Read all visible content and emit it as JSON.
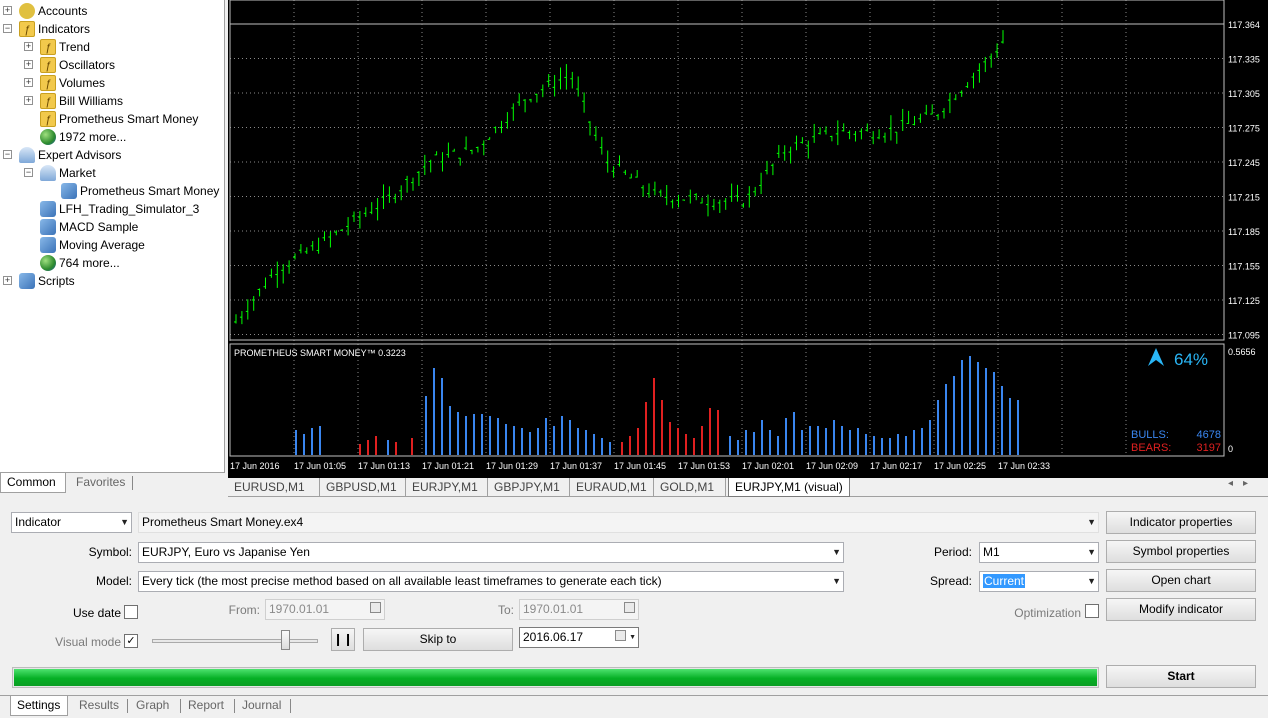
{
  "navigator": {
    "items": [
      {
        "label": "Accounts",
        "icon": "accounts-icon",
        "expander": "+"
      },
      {
        "label": "Indicators",
        "icon": "folder-icon",
        "expander": "−"
      },
      {
        "label": "Trend",
        "icon": "indicator-folder-icon",
        "expander": "+"
      },
      {
        "label": "Oscillators",
        "icon": "indicator-folder-icon",
        "expander": "+"
      },
      {
        "label": "Volumes",
        "icon": "indicator-folder-icon",
        "expander": "+"
      },
      {
        "label": "Bill Williams",
        "icon": "indicator-folder-icon",
        "expander": "+"
      },
      {
        "label": "Prometheus Smart Money",
        "icon": "indicator-icon",
        "expander": ""
      },
      {
        "label": "1972 more...",
        "icon": "globe-icon",
        "expander": ""
      },
      {
        "label": "Expert Advisors",
        "icon": "experts-icon",
        "expander": "−"
      },
      {
        "label": "Market",
        "icon": "market-icon",
        "expander": "−"
      },
      {
        "label": "Prometheus Smart Money",
        "icon": "expert-icon",
        "expander": ""
      },
      {
        "label": "LFH_Trading_Simulator_3",
        "icon": "expert-icon",
        "expander": ""
      },
      {
        "label": "MACD Sample",
        "icon": "expert-icon",
        "expander": ""
      },
      {
        "label": "Moving Average",
        "icon": "expert-icon",
        "expander": ""
      },
      {
        "label": "764 more...",
        "icon": "globe-icon",
        "expander": ""
      },
      {
        "label": "Scripts",
        "icon": "scripts-icon",
        "expander": "+"
      }
    ],
    "tabs": [
      "Common",
      "Favorites"
    ]
  },
  "chart": {
    "price_labels": [
      "117.364",
      "117.335",
      "117.305",
      "117.275",
      "117.245",
      "117.215",
      "117.185",
      "117.155",
      "117.125",
      "117.095"
    ],
    "current_price": "117.364",
    "indicator_title": "PROMETHEUS SMART MONEY™ 0.3223",
    "indicator_max": "0.5656",
    "indicator_min": "0",
    "percent": "64%",
    "bulls_label": "BULLS:",
    "bulls_value": "4678",
    "bears_label": "BEARS:",
    "bears_value": "3197",
    "time_labels": [
      "17 Jun 2016",
      "17 Jun 01:05",
      "17 Jun 01:13",
      "17 Jun 01:21",
      "17 Jun 01:29",
      "17 Jun 01:37",
      "17 Jun 01:45",
      "17 Jun 01:53",
      "17 Jun 02:01",
      "17 Jun 02:09",
      "17 Jun 02:17",
      "17 Jun 02:25",
      "17 Jun 02:33"
    ],
    "colors": {
      "candles": "#00ff00",
      "grid": "#8a8a8a",
      "bulls": "#3a86f0",
      "bears": "#e02020",
      "percent": "#29b6f6"
    }
  },
  "chart_tabs": [
    "EURUSD,M1",
    "GBPUSD,M1",
    "EURJPY,M1",
    "GBPJPY,M1",
    "EURAUD,M1",
    "GOLD,M1",
    "EURJPY,M1 (visual)"
  ],
  "tester": {
    "type": "Indicator",
    "program": "Prometheus Smart Money.ex4",
    "symbol_label": "Symbol:",
    "symbol": "EURJPY, Euro vs Japanise Yen",
    "model_label": "Model:",
    "model": "Every tick (the most precise method based on all available least timeframes to generate each tick)",
    "use_date_label": "Use date",
    "from_label": "From:",
    "from_value": "1970.01.01",
    "to_label": "To:",
    "to_value": "1970.01.01",
    "visual_mode_label": "Visual mode",
    "visual_mode_checked": "✓",
    "pause": "❙❙",
    "skip_to": "Skip to",
    "skip_date": "2016.06.17",
    "period_label": "Period:",
    "period": "M1",
    "spread_label": "Spread:",
    "spread": "Current",
    "optimization_label": "Optimization",
    "buttons": {
      "indicator_properties": "Indicator properties",
      "symbol_properties": "Symbol properties",
      "open_chart": "Open chart",
      "modify_indicator": "Modify indicator",
      "start": "Start"
    },
    "progress": 1.0
  },
  "bottom_tabs": [
    "Settings",
    "Results",
    "Graph",
    "Report",
    "Journal"
  ]
}
